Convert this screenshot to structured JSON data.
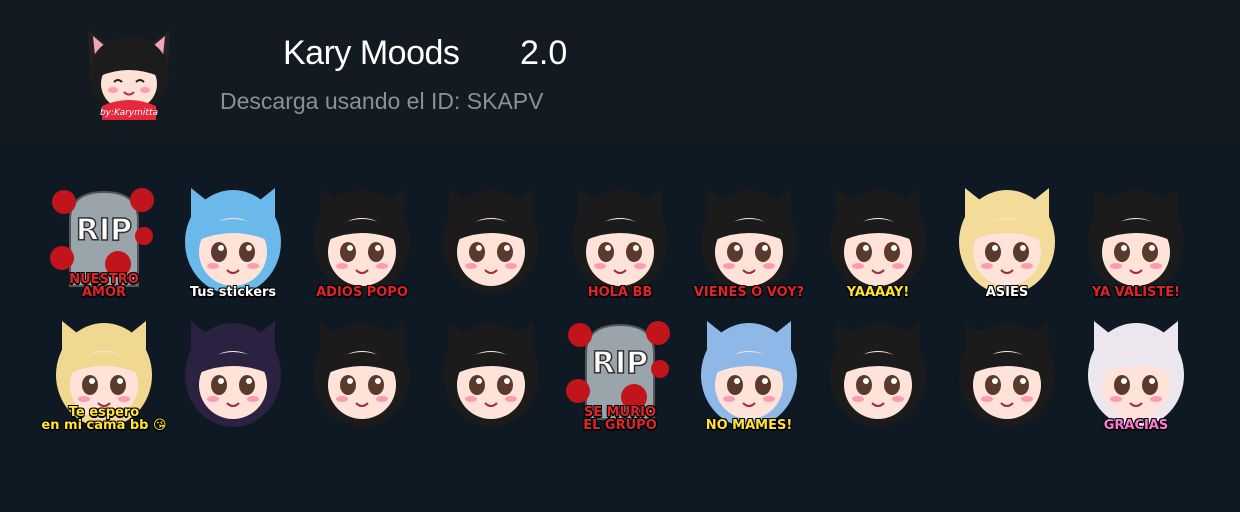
{
  "pack": {
    "name": "Kary Moods",
    "version": "2.0",
    "subtitle": "Descarga usando el ID: SKAPV",
    "icon_caption": "by:Karymitta"
  },
  "colors": {
    "header_bg": "#131a21",
    "page_bg": "#0e1923",
    "title": "#ffffff",
    "subtitle": "#8b9199"
  },
  "stickers": [
    {
      "caption": "NUESTRO\nAMOR",
      "color": "#e0242a",
      "icon": "rip-tombstone-icon"
    },
    {
      "caption": "Tus stickers",
      "color": "#ffffff",
      "icon": "blue-hair-heart-icon"
    },
    {
      "caption": "ADIOS POPO",
      "color": "#e0242a",
      "icon": "cat-ears-wave-icon"
    },
    {
      "caption": "",
      "color": "#ffffff",
      "icon": "bunny-heart-icon"
    },
    {
      "caption": "HOLA BB",
      "color": "#e0242a",
      "icon": "wink-heart-icon"
    },
    {
      "caption": "VIENES O VOY?",
      "color": "#e0242a",
      "icon": "devil-horns-icon"
    },
    {
      "caption": "YAAAAY!",
      "color": "#ffe233",
      "icon": "yay-icon"
    },
    {
      "caption": "ASIES",
      "color": "#ffffff",
      "icon": "sunglasses-icon"
    },
    {
      "caption": "YA VALISTE!",
      "color": "#e0242a",
      "icon": "devil-gun-icon"
    },
    {
      "caption": "Te espero\nen mi cama bb 😘",
      "color": "#ffe233",
      "icon": "blonde-blush-icon"
    },
    {
      "caption": "",
      "color": "#ffffff",
      "icon": "purple-eyes-icon"
    },
    {
      "caption": "",
      "color": "#ffffff",
      "icon": "headpat-icon"
    },
    {
      "caption": "",
      "color": "#ffffff",
      "icon": "panda-ears-icon"
    },
    {
      "caption": "SE MURIO\nEL GRUPO",
      "color": "#e0242a",
      "icon": "rip-tombstone-icon"
    },
    {
      "caption": "NO MAMES!",
      "color": "#ffe233",
      "icon": "shocked-icon"
    },
    {
      "caption": "",
      "color": "#ffffff",
      "icon": "angry-knife-icon"
    },
    {
      "caption": "",
      "color": "#ffffff",
      "icon": "crying-icon"
    },
    {
      "caption": "GRACIAS",
      "color": "#ff78d2",
      "icon": "flower-crown-bear-icon"
    }
  ]
}
